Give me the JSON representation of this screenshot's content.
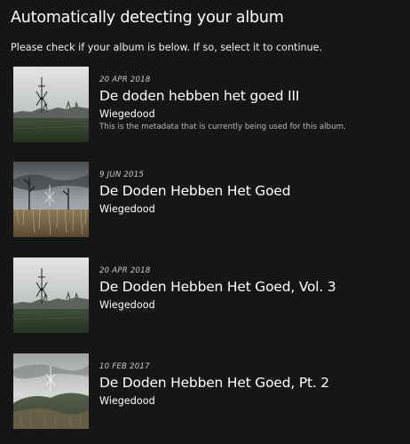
{
  "header": {
    "title": "Automatically detecting your album",
    "instructions": "Please check if your album is below. If so, select it to continue."
  },
  "albums": [
    {
      "date": "20 APR 2018",
      "title": "De doden hebben het goed III",
      "artist": "Wiegedood",
      "note": "This is the metadata that is currently being used for this album.",
      "cover_icon": "album-cover-field-sigil"
    },
    {
      "date": "9 JUN 2015",
      "title": "De Doden Hebben Het Goed",
      "artist": "Wiegedood",
      "cover_icon": "album-cover-reeds-sigil"
    },
    {
      "date": "20 APR 2018",
      "title": "De Doden Hebben Het Goed, Vol. 3",
      "artist": "Wiegedood",
      "cover_icon": "album-cover-field-sigil"
    },
    {
      "date": "10 FEB 2017",
      "title": "De Doden Hebben Het Goed, Pt. 2",
      "artist": "Wiegedood",
      "cover_icon": "album-cover-hill-sigil"
    }
  ]
}
